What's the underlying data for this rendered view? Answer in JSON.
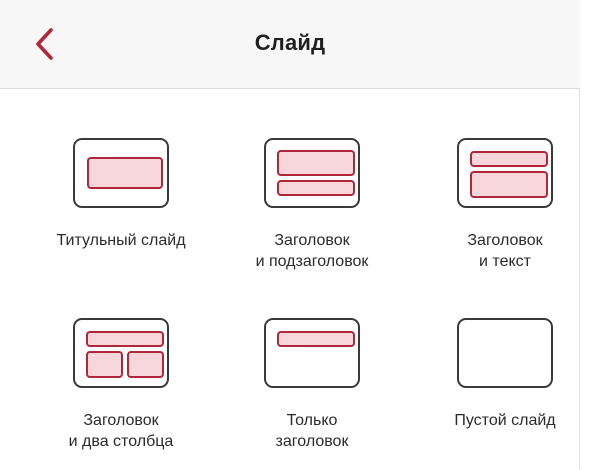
{
  "header": {
    "title": "Слайд",
    "back_icon": "chevron-left-icon"
  },
  "colors": {
    "accent": "#b0263a",
    "placeholder_fill": "#f8d7db",
    "thumb_border": "#3a3a3a",
    "header_bg": "#f7f7f8"
  },
  "layouts": [
    {
      "line1": "Титульный слайд",
      "line2": ""
    },
    {
      "line1": "Заголовок",
      "line2": "и подзаголовок"
    },
    {
      "line1": "Заголовок",
      "line2": "и текст"
    },
    {
      "line1": "Заголовок",
      "line2": "и два столбца"
    },
    {
      "line1": "Только",
      "line2": "заголовок"
    },
    {
      "line1": "Пустой слайд",
      "line2": ""
    }
  ]
}
